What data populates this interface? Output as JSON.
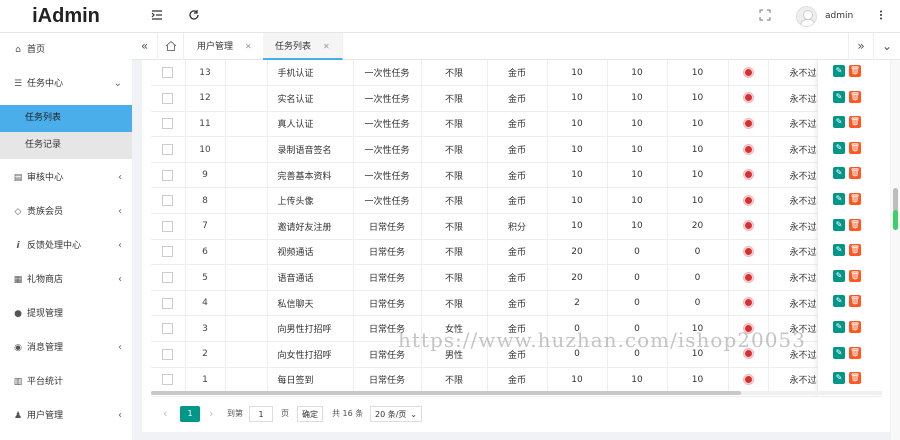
{
  "app": {
    "title": "iAdmin",
    "user": "admin"
  },
  "header_icons": [
    "menu-collapse-icon",
    "refresh-icon",
    "fullscreen-icon",
    "more-vertical-icon"
  ],
  "sidebar": {
    "items": [
      {
        "label": "首页",
        "icon": "home-icon",
        "has_arrow": false
      },
      {
        "label": "任务中心",
        "icon": "list-icon",
        "has_arrow": true,
        "expanded": true
      },
      {
        "label": "审核中心",
        "icon": "audit-icon",
        "has_arrow": true
      },
      {
        "label": "贵族会员",
        "icon": "diamond-icon",
        "has_arrow": true
      },
      {
        "label": "反馈处理中心",
        "icon": "info-icon",
        "has_arrow": true
      },
      {
        "label": "礼物商店",
        "icon": "store-icon",
        "has_arrow": true
      },
      {
        "label": "提现管理",
        "icon": "money-bag-icon",
        "has_arrow": false
      },
      {
        "label": "消息管理",
        "icon": "message-icon",
        "has_arrow": true
      },
      {
        "label": "平台统计",
        "icon": "bar-chart-icon",
        "has_arrow": false
      },
      {
        "label": "用户管理",
        "icon": "user-icon",
        "has_arrow": true
      }
    ],
    "sub_items": [
      {
        "label": "任务列表",
        "active": true
      },
      {
        "label": "任务记录",
        "active": false
      }
    ]
  },
  "tabs": [
    {
      "label": "用户管理",
      "active": false
    },
    {
      "label": "任务列表",
      "active": true
    }
  ],
  "table": {
    "rows": [
      [
        "13",
        "手机认证",
        "一次性任务",
        "不限",
        "金币",
        "10",
        "10",
        "10",
        "永不过期"
      ],
      [
        "12",
        "实名认证",
        "一次性任务",
        "不限",
        "金币",
        "10",
        "10",
        "10",
        "永不过期"
      ],
      [
        "11",
        "真人认证",
        "一次性任务",
        "不限",
        "金币",
        "10",
        "10",
        "10",
        "永不过期"
      ],
      [
        "10",
        "录制语音签名",
        "一次性任务",
        "不限",
        "金币",
        "10",
        "10",
        "10",
        "永不过期"
      ],
      [
        "9",
        "完善基本资料",
        "一次性任务",
        "不限",
        "金币",
        "10",
        "10",
        "10",
        "永不过期"
      ],
      [
        "8",
        "上传头像",
        "一次性任务",
        "不限",
        "金币",
        "10",
        "10",
        "10",
        "永不过期"
      ],
      [
        "7",
        "邀请好友注册",
        "日常任务",
        "不限",
        "积分",
        "10",
        "10",
        "20",
        "永不过期"
      ],
      [
        "6",
        "视频通话",
        "日常任务",
        "不限",
        "金币",
        "20",
        "0",
        "0",
        "永不过期"
      ],
      [
        "5",
        "语音通话",
        "日常任务",
        "不限",
        "金币",
        "20",
        "0",
        "0",
        "永不过期"
      ],
      [
        "4",
        "私信聊天",
        "日常任务",
        "不限",
        "金币",
        "2",
        "0",
        "0",
        "永不过期"
      ],
      [
        "3",
        "向男性打招呼",
        "日常任务",
        "女性",
        "金币",
        "0",
        "0",
        "10",
        "永不过期"
      ],
      [
        "2",
        "向女性打招呼",
        "日常任务",
        "男性",
        "金币",
        "0",
        "0",
        "10",
        "永不过期"
      ],
      [
        "1",
        "每日签到",
        "日常任务",
        "不限",
        "金币",
        "10",
        "10",
        "10",
        "永不过期"
      ]
    ]
  },
  "pagination": {
    "current": "1",
    "goto_label": "到第",
    "goto_value": "1",
    "page_suffix": "页",
    "confirm": "确定",
    "total": "共 16 条",
    "page_size": "20 条/页"
  },
  "watermark": "https://www.huzhan.com/ishop20053"
}
